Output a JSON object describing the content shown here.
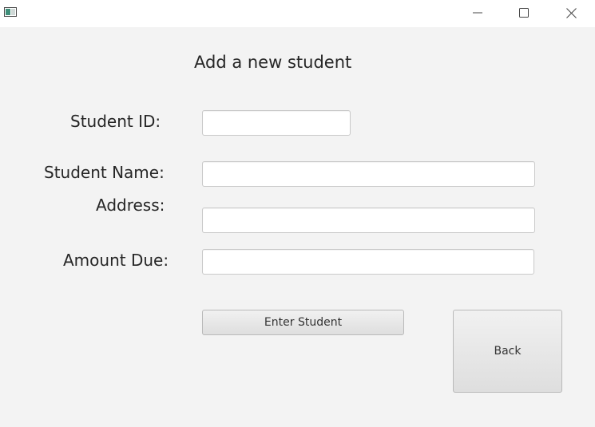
{
  "window": {
    "app_icon": "java-app-icon",
    "controls": {
      "minimize_icon": "minimize-icon",
      "maximize_icon": "maximize-icon",
      "close_icon": "close-icon"
    }
  },
  "form": {
    "heading": "Add a new student",
    "fields": {
      "student_id": {
        "label": "Student ID:",
        "value": ""
      },
      "student_name": {
        "label": "Student Name:",
        "value": ""
      },
      "address": {
        "label": "Address:",
        "value": ""
      },
      "amount_due": {
        "label": "Amount Due:",
        "value": ""
      }
    },
    "buttons": {
      "enter": "Enter Student",
      "back": "Back"
    }
  }
}
